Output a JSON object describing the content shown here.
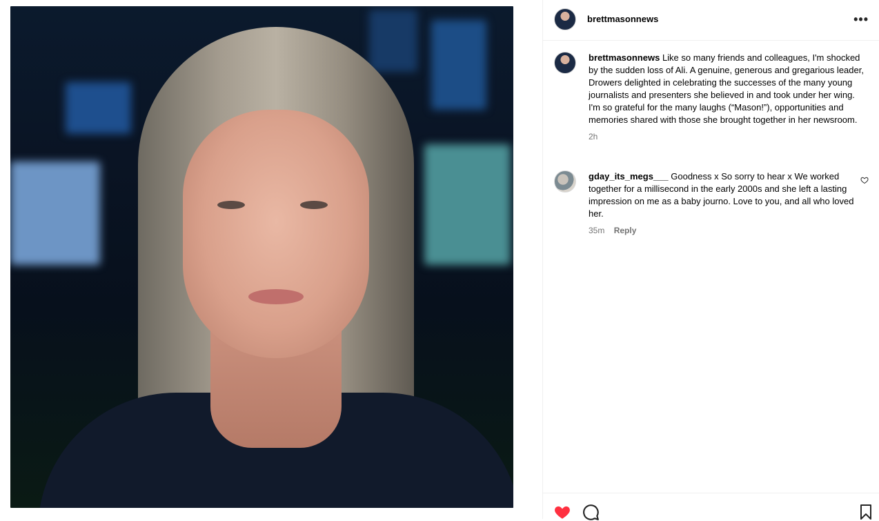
{
  "post": {
    "author": "brettmasonnews",
    "more_icon": "more-horizontal-icon"
  },
  "caption": {
    "username": "brettmasonnews",
    "text": "Like so many friends and colleagues, I'm shocked by the sudden loss of Ali. A genuine, generous and gregarious leader, Drowers delighted in celebrating the successes of the many young journalists and presenters she believed in and took under her wing. I'm so grateful for the many laughs (“Mason!”), opportunities and memories shared with those she brought together in her newsroom.",
    "time": "2h"
  },
  "comments": [
    {
      "username": "gday_its_megs___",
      "text": "Goodness x So sorry to hear x We worked together for a millisecond in the early 2000s and she left a lasting impression on me as a baby journo. Love to you, and all who loved her.",
      "time": "35m",
      "reply_label": "Reply"
    }
  ],
  "actions": {
    "liked": true,
    "like_color": "#ff3040"
  }
}
